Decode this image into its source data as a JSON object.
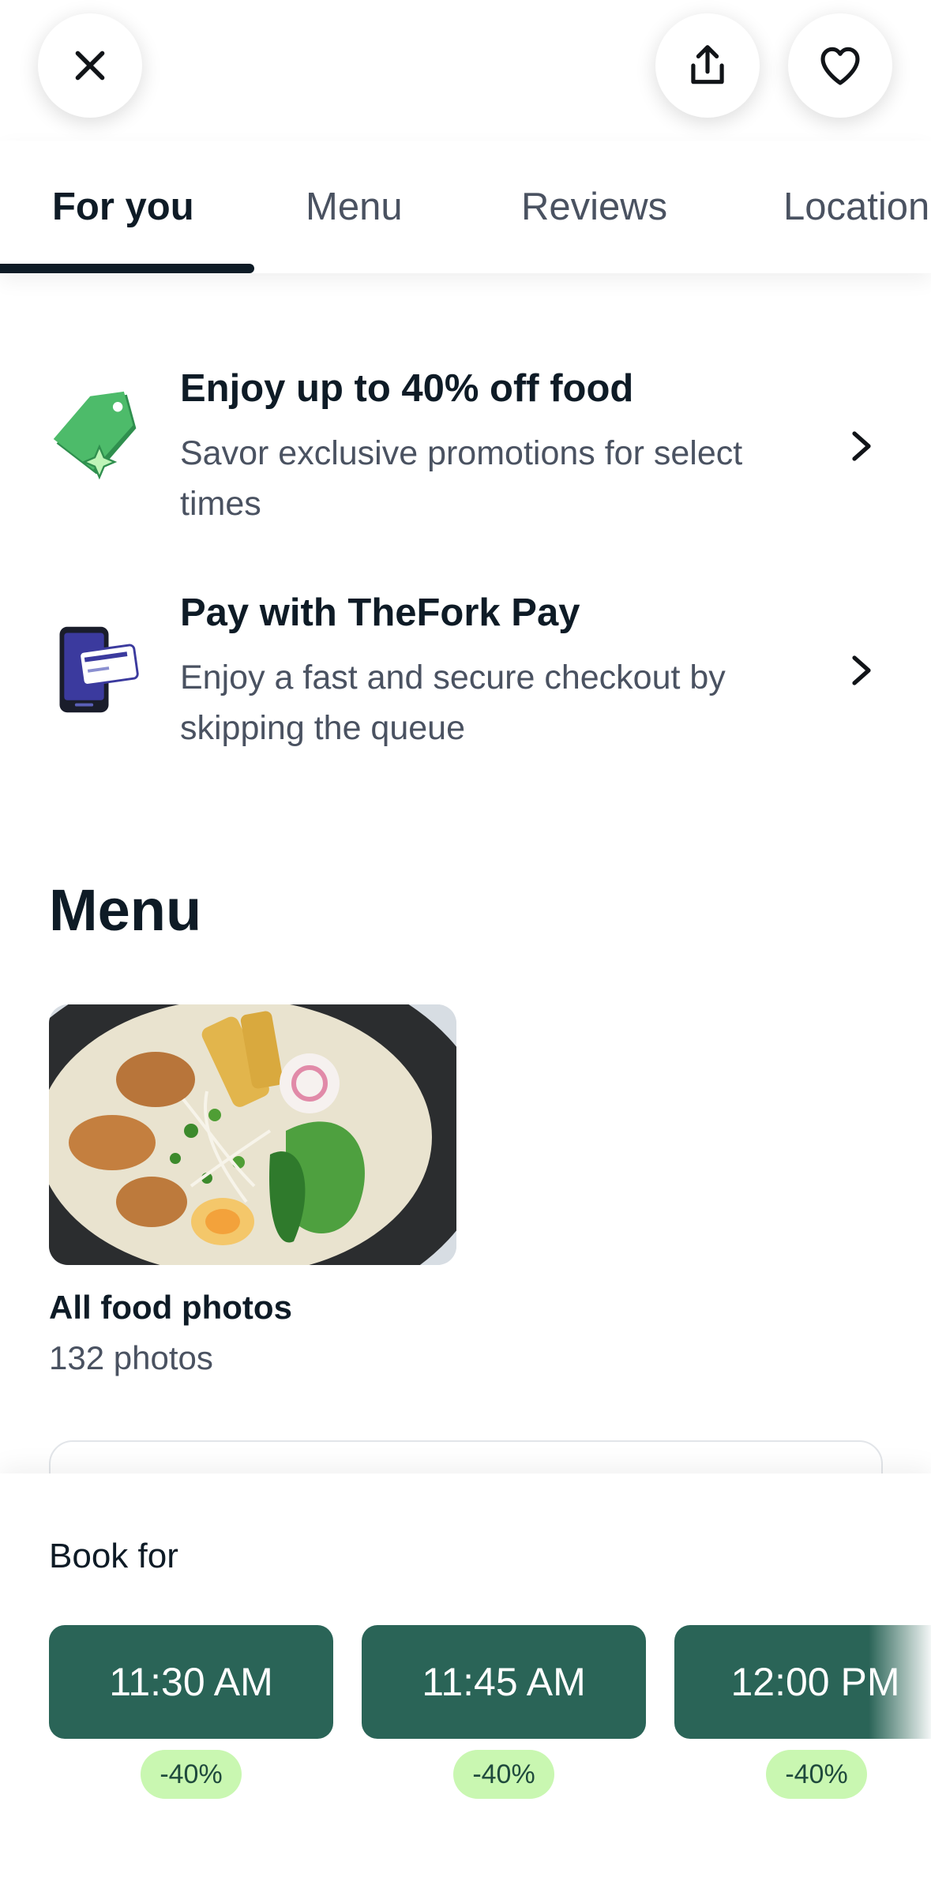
{
  "header": {
    "close_icon": "close-icon",
    "share_icon": "share-icon",
    "favorite_icon": "heart-icon"
  },
  "tabs": [
    {
      "label": "For you",
      "active": true
    },
    {
      "label": "Menu",
      "active": false
    },
    {
      "label": "Reviews",
      "active": false
    },
    {
      "label": "Location",
      "active": false
    }
  ],
  "promos": [
    {
      "icon": "price-tag-icon",
      "title": "Enjoy up to 40% off food",
      "description": "Savor exclusive promotions for select times"
    },
    {
      "icon": "phone-card-icon",
      "title": "Pay with TheFork Pay",
      "description": "Enjoy a fast and secure checkout by skipping the queue"
    }
  ],
  "menu": {
    "heading": "Menu",
    "photo_title": "All food photos",
    "photo_count": "132 photos"
  },
  "booking": {
    "label": "Book for",
    "slots": [
      {
        "time": "11:30 AM",
        "discount": "-40%"
      },
      {
        "time": "11:45 AM",
        "discount": "-40%"
      },
      {
        "time": "12:00 PM",
        "discount": "-40%"
      }
    ]
  },
  "colors": {
    "accent": "#2a6457",
    "discount_bg": "#c9f7b1",
    "text_primary": "#0e1b26",
    "text_secondary": "#4a5261"
  }
}
